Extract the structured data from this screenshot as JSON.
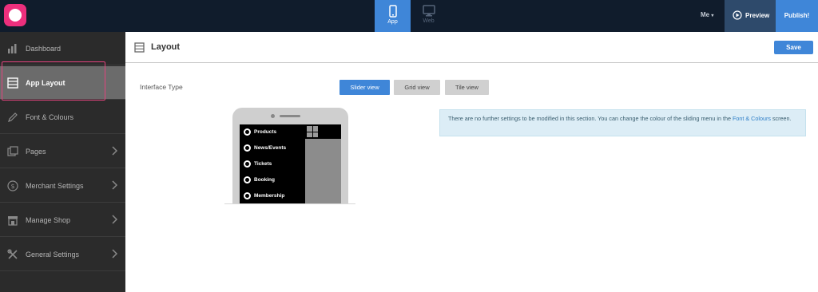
{
  "topbar": {
    "tabs": [
      {
        "label": "App",
        "icon": "mobile-icon"
      },
      {
        "label": "Web",
        "icon": "monitor-icon"
      }
    ],
    "user_menu": "Me",
    "preview_label": "Preview",
    "publish_label": "Publish!"
  },
  "sidebar": {
    "items": [
      {
        "label": "Dashboard",
        "icon": "chart-icon"
      },
      {
        "label": "App Layout",
        "icon": "layout-icon"
      },
      {
        "label": "Font & Colours",
        "icon": "pencil-icon"
      },
      {
        "label": "Pages",
        "icon": "pages-icon"
      },
      {
        "label": "Merchant Settings",
        "icon": "dollar-icon"
      },
      {
        "label": "Manage Shop",
        "icon": "shop-icon"
      },
      {
        "label": "General Settings",
        "icon": "tools-icon"
      }
    ]
  },
  "header": {
    "title": "Layout",
    "save_label": "Save"
  },
  "main": {
    "interface_type_label": "Interface Type",
    "view_options": [
      "Slider view",
      "Grid view",
      "Tile view"
    ],
    "selected_view": "Slider view",
    "info_text_before": "There are no further settings to be modified in this section. You can change the colour of the sliding menu in the ",
    "info_link": "Font & Colours",
    "info_text_after": " screen."
  },
  "phone_preview": {
    "menu_items": [
      "Products",
      "News/Events",
      "Tickets",
      "Booking",
      "Membership"
    ]
  },
  "colors": {
    "accent": "#3f86d8",
    "topbar": "#101c2c",
    "sidebar": "#2b2b2b",
    "highlight": "#e4437e",
    "logo": "#ec2f7d"
  }
}
